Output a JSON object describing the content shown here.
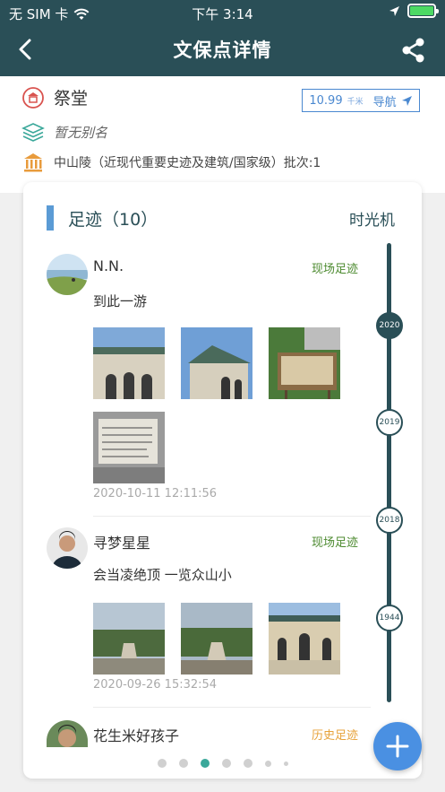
{
  "status": {
    "carrier": "无 SIM 卡",
    "time": "下午 3:14"
  },
  "nav": {
    "title": "文保点详情"
  },
  "info": {
    "name": "祭堂",
    "alias": "暂无别名",
    "site": "中山陵（近现代重要史迹及建筑/国家级）批次:1",
    "distance_value": "10.99",
    "distance_unit": "千米",
    "navigate_label": "导航"
  },
  "card": {
    "title": "足迹（10）",
    "time_machine": "时光机"
  },
  "timeline": {
    "years": [
      "2020",
      "2019",
      "2018",
      "1944"
    ],
    "active": "2020"
  },
  "posts": [
    {
      "user": "N.N.",
      "type": "现场足迹",
      "text": "到此一游",
      "time": "2020-10-11 12:11:56"
    },
    {
      "user": "寻梦星星",
      "type": "现场足迹",
      "text": "会当凌绝顶 一览众山小",
      "time": "2020-09-26 15:32:54"
    },
    {
      "user": "花生米好孩子",
      "type": "历史足迹"
    }
  ],
  "colors": {
    "primary": "#2a4f57",
    "accent": "#5b9bd5",
    "live": "#4c8a2f",
    "history": "#e7a23a",
    "fab": "#4a90e2"
  }
}
